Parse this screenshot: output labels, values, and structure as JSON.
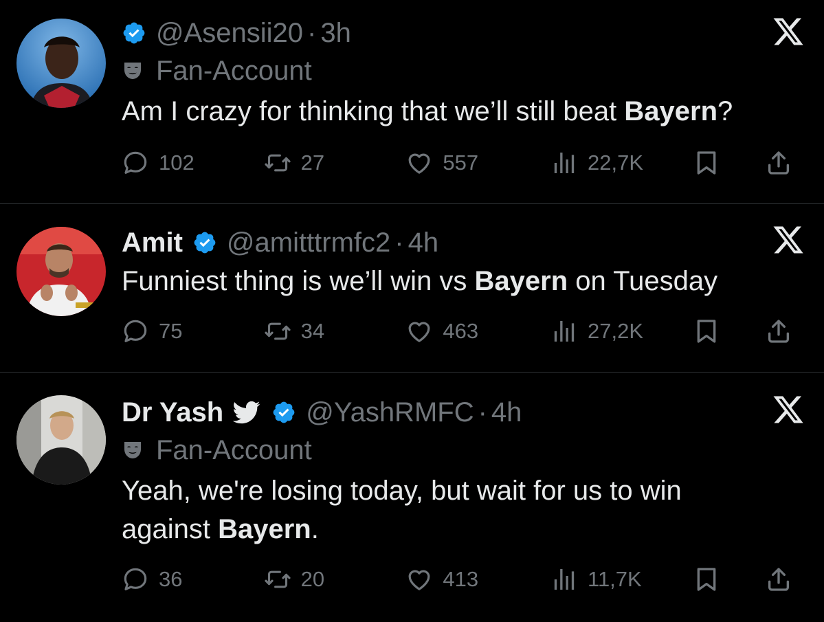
{
  "colors": {
    "background": "#000000",
    "text": "#e7e9ea",
    "muted": "#71767b",
    "verified": "#1d9bf0",
    "divider": "#2f3336"
  },
  "tweets": [
    {
      "name": "",
      "handle": "@Asensii20",
      "time": "3h",
      "label": "Fan-Account",
      "text_before": "Am I crazy for thinking that we’ll still beat ",
      "text_bold": "Bayern",
      "text_after": "?",
      "replies": "102",
      "reposts": "27",
      "likes": "557",
      "views": "22,7K"
    },
    {
      "name": "Amit",
      "handle": "@amitttrmfc2",
      "time": "4h",
      "label": "",
      "text_before": "Funniest thing is we’ll win vs ",
      "text_bold": "Bayern",
      "text_after": " on Tuesday",
      "replies": "75",
      "reposts": "34",
      "likes": "463",
      "views": "27,2K"
    },
    {
      "name": "Dr Yash",
      "handle": "@YashRMFC",
      "time": "4h",
      "label": "Fan-Account",
      "text_before": "Yeah, we're losing today, but wait for us to win against ",
      "text_bold": "Bayern",
      "text_after": ".",
      "replies": "36",
      "reposts": "20",
      "likes": "413",
      "views": "11,7K"
    }
  ],
  "icons": {
    "verified": "verified-badge-icon",
    "label": "theater-mask-icon",
    "bird": "twitter-bird-icon",
    "x": "x-logo-icon",
    "reply": "reply-icon",
    "repost": "repost-icon",
    "like": "heart-icon",
    "views": "views-icon",
    "bookmark": "bookmark-icon",
    "share": "share-icon"
  }
}
